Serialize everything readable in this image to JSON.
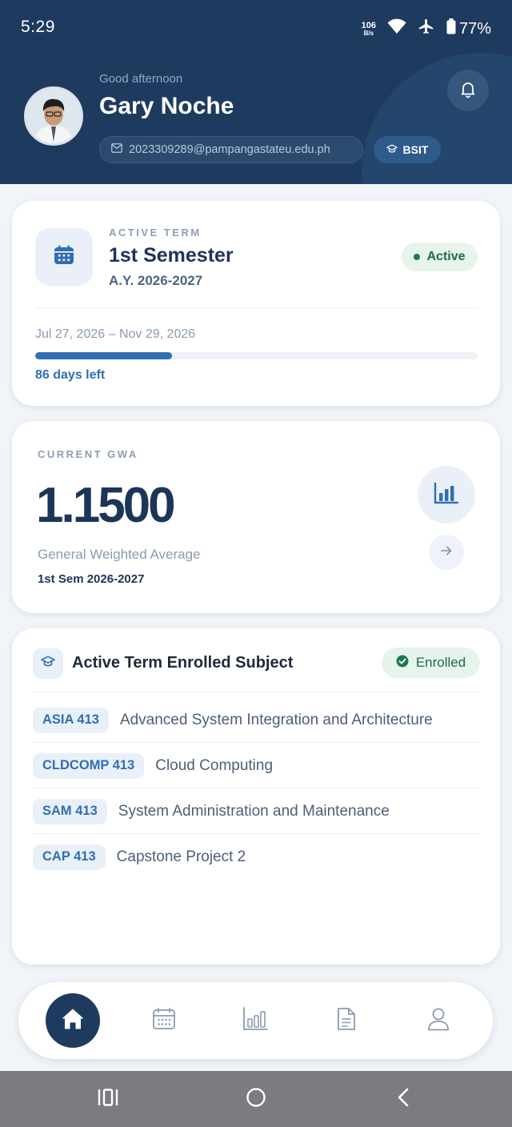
{
  "status_bar": {
    "time": "5:29",
    "net_speed_value": "106",
    "net_speed_unit": "B/s",
    "battery": "77%",
    "icons": [
      "wifi-icon",
      "airplane-icon",
      "battery-icon"
    ]
  },
  "header": {
    "greeting": "Good afternoon",
    "name": "Gary Noche",
    "email": "2023309289@pampangastateu.edu.ph",
    "course": "BSIT",
    "icons": [
      "mail-icon",
      "graduation-cap-icon",
      "bell-icon"
    ]
  },
  "term_card": {
    "overline": "ACTIVE TERM",
    "title": "1st Semester",
    "academic_year": "A.Y. 2026-2027",
    "status": "Active",
    "dates": "Jul 27, 2026 – Nov 29, 2026",
    "progress_fraction": 0.31,
    "days_left": "86 days left",
    "icon": "calendar-icon"
  },
  "gwa_card": {
    "overline": "CURRENT GWA",
    "value": "1.1500",
    "label": "General Weighted Average",
    "semester": "1st Sem 2026-2027",
    "icons": [
      "bar-chart-icon",
      "arrow-right-icon"
    ]
  },
  "subjects_card": {
    "title": "Active Term Enrolled Subject",
    "badge": "Enrolled",
    "subjects": [
      {
        "code": "ASIA 413",
        "name": "Advanced System Integration and Architecture"
      },
      {
        "code": "CLDCOMP 413",
        "name": "Cloud Computing"
      },
      {
        "code": "SAM 413",
        "name": "System Administration and Maintenance"
      },
      {
        "code": "CAP 413",
        "name": "Capstone Project 2"
      }
    ]
  },
  "bottom_nav": {
    "items": [
      "home",
      "calendar",
      "grades",
      "documents",
      "profile"
    ],
    "active": "home"
  },
  "colors": {
    "header_bg": "#1e3b5f",
    "accent": "#2f6fb2",
    "success": "#1e6b45",
    "success_bg": "#e6f4ec"
  }
}
